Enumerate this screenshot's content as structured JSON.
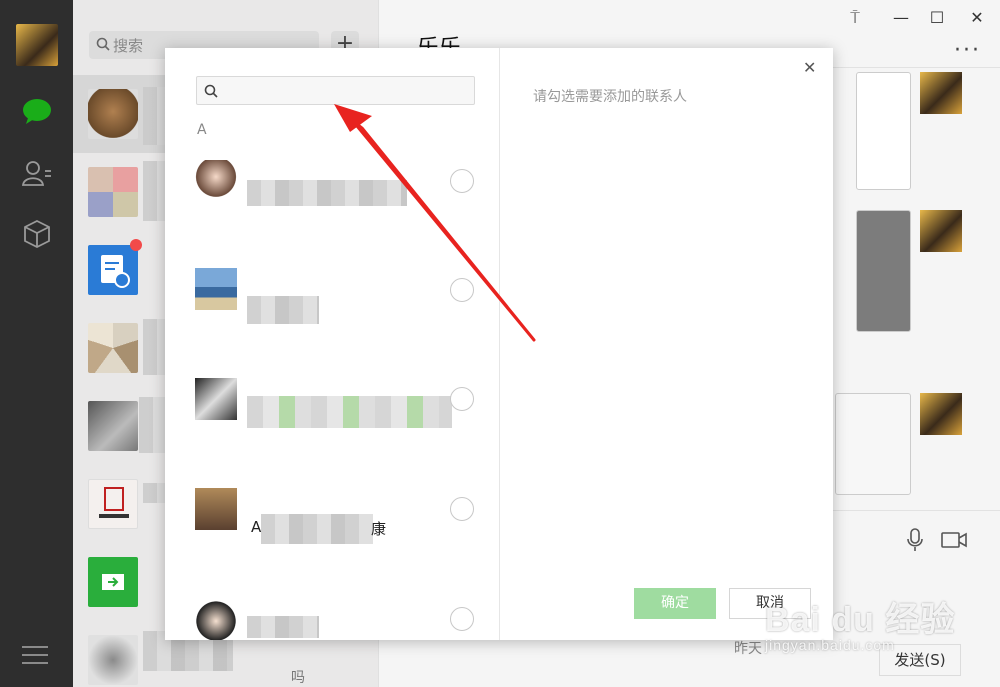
{
  "sidebar": {
    "search_placeholder": "搜索",
    "add_label": "+"
  },
  "chat": {
    "title": "乐乐",
    "more_label": "···",
    "send_label": "发送(S)",
    "last_snippet": "昨天",
    "last_snippet_tail": "吗"
  },
  "window": {
    "pin_label": "⍑",
    "minimize_label": "—",
    "maximize_label": "☐",
    "close_label": "✕"
  },
  "dialog": {
    "search_placeholder": "",
    "section_letter": "A",
    "hint": "请勾选需要添加的联系人",
    "close_label": "✕",
    "confirm_label": "确定",
    "cancel_label": "取消",
    "contact_partial_char": "康",
    "contact_partial_prefix": "A"
  },
  "watermark": {
    "main": "Bai du 经验",
    "sub": "jingyan.baidu.com"
  },
  "colors": {
    "nav_bg": "#2e2e2e",
    "wechat_green": "#1aad19",
    "confirm_disabled": "#9fdca0",
    "arrow_red": "#e8231f"
  }
}
